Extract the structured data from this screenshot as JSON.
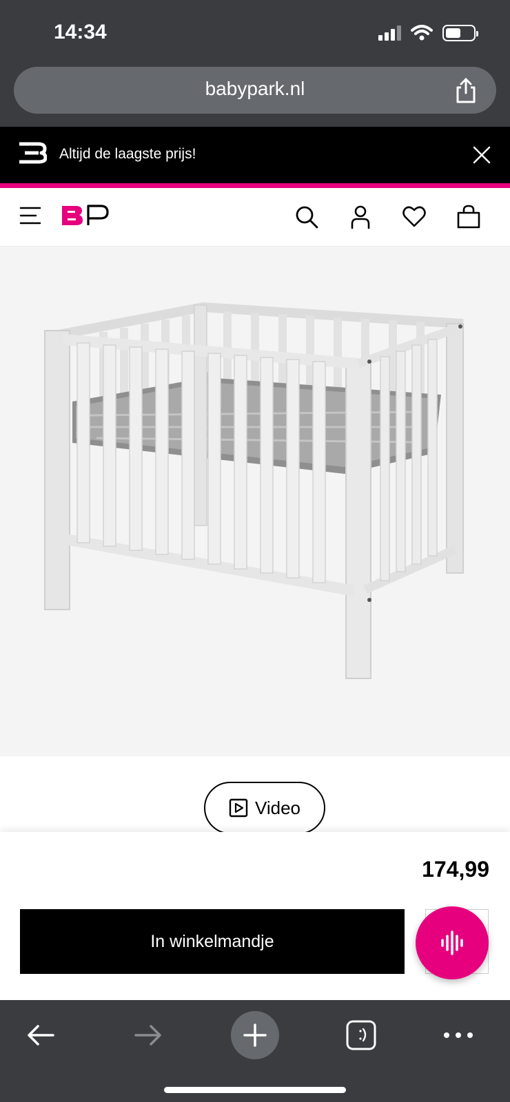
{
  "status_bar": {
    "time": "14:34"
  },
  "browser": {
    "url": "babypark.nl"
  },
  "promo": {
    "text": "Altijd de laagste prijs!"
  },
  "product": {
    "video_label": "Video",
    "price": "174,99",
    "cart_label": "In winkelmandje"
  },
  "colors": {
    "brand_pink": "#e6007e",
    "chrome_dark": "#3a3c40",
    "black": "#000000"
  },
  "icons": [
    "menu-icon",
    "search-icon",
    "user-icon",
    "heart-icon",
    "bag-icon",
    "play-icon",
    "voice-icon",
    "back-arrow-icon",
    "forward-arrow-icon",
    "plus-icon",
    "tabs-icon",
    "more-icon",
    "share-icon",
    "close-icon"
  ]
}
